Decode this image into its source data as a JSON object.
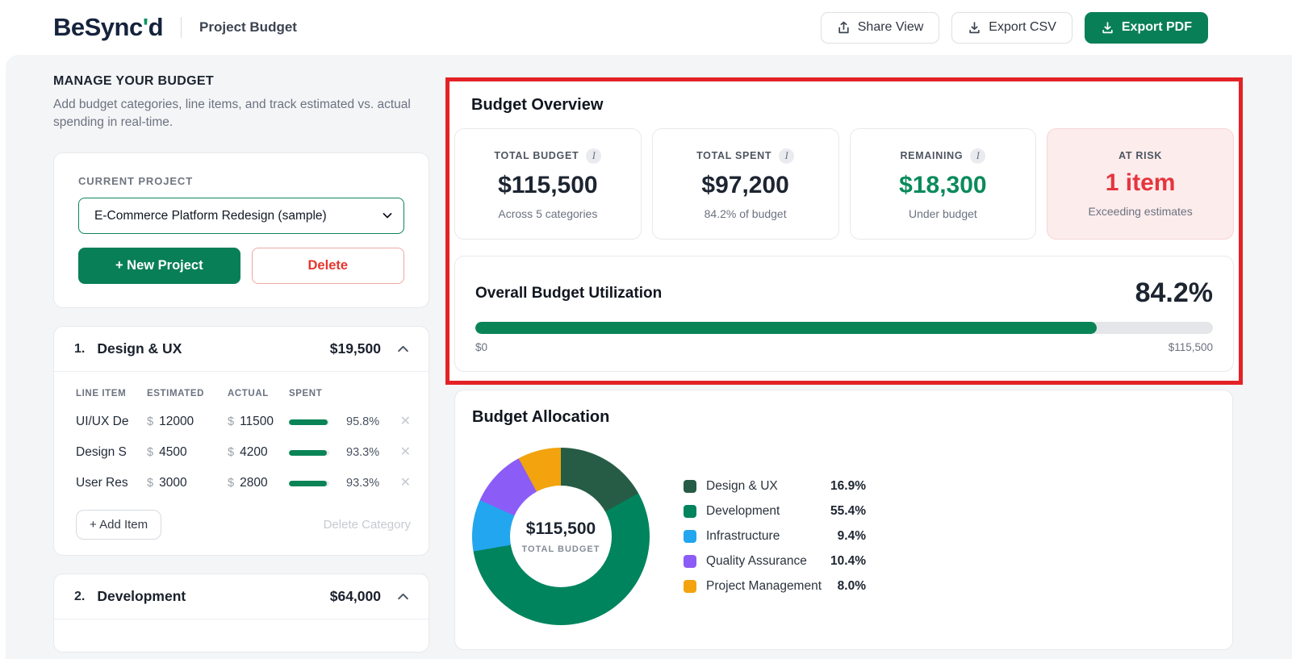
{
  "header": {
    "logo_pre": "BeSync",
    "logo_apos": "'",
    "logo_post": "d",
    "page_title": "Project Budget",
    "share_label": "Share View",
    "export_csv_label": "Export CSV",
    "export_pdf_label": "Export PDF"
  },
  "sidebar": {
    "heading": "MANAGE YOUR BUDGET",
    "description": "Add budget categories, line items, and track estimated vs. actual spending in real-time.",
    "currency_symbol": "$",
    "project": {
      "label": "CURRENT PROJECT",
      "selected": "E-Commerce Platform Redesign (sample)",
      "new_button": "+ New Project",
      "delete_button": "Delete"
    },
    "table_headers": [
      "LINE ITEM",
      "ESTIMATED",
      "ACTUAL",
      "SPENT"
    ],
    "categories": [
      {
        "index": "1.",
        "name": "Design & UX",
        "total": "$19,500",
        "items": [
          {
            "name": "UI/UX De",
            "estimated": "12000",
            "actual": "11500",
            "spent_pct": "95.8%",
            "spent_num": 95.8
          },
          {
            "name": "Design S",
            "estimated": "4500",
            "actual": "4200",
            "spent_pct": "93.3%",
            "spent_num": 93.3
          },
          {
            "name": "User Res",
            "estimated": "3000",
            "actual": "2800",
            "spent_pct": "93.3%",
            "spent_num": 93.3
          }
        ],
        "close_glyph": "✕",
        "add_item_label": "+ Add Item",
        "delete_category_label": "Delete Category"
      },
      {
        "index": "2.",
        "name": "Development",
        "total": "$64,000"
      }
    ]
  },
  "overview": {
    "title": "Budget Overview",
    "info_glyph": "I",
    "stats": [
      {
        "label": "TOTAL BUDGET",
        "value": "$115,500",
        "sub": "Across 5 categories"
      },
      {
        "label": "TOTAL SPENT",
        "value": "$97,200",
        "sub": "84.2% of budget"
      },
      {
        "label": "REMAINING",
        "value": "$18,300",
        "sub": "Under budget"
      },
      {
        "label": "AT RISK",
        "value": "1 item",
        "sub": "Exceeding estimates"
      }
    ],
    "utilization": {
      "title": "Overall Budget Utilization",
      "pct_label": "84.2%",
      "pct": 84.2,
      "min_label": "$0",
      "max_label": "$115,500"
    }
  },
  "allocation": {
    "title": "Budget Allocation"
  },
  "chart_data": {
    "type": "pie",
    "title": "Budget Allocation",
    "labels": [
      "Design & UX",
      "Development",
      "Infrastructure",
      "Quality Assurance",
      "Project Management"
    ],
    "values": [
      16.9,
      55.4,
      9.4,
      10.4,
      8.0
    ],
    "value_labels": [
      "16.9%",
      "55.4%",
      "9.4%",
      "10.4%",
      "8.0%"
    ],
    "colors": [
      "#265C45",
      "#00845E",
      "#22A6EF",
      "#8C5CF6",
      "#F2A30D"
    ],
    "center_value": "$115,500",
    "center_label": "TOTAL BUDGET",
    "legend_position": "right",
    "donut": true
  },
  "colors": {
    "primary_green": "#087F57",
    "progress_green": "#0A8457",
    "remaining_green": "#0A8A5C",
    "risk_red": "#E5353E",
    "highlight_red": "#E32227",
    "navy": "#15233C"
  }
}
